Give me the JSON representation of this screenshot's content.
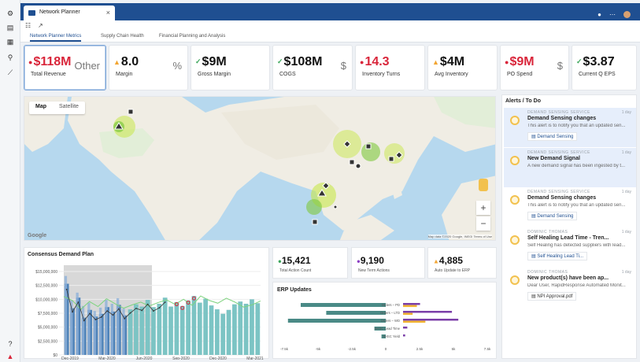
{
  "window": {
    "tab_title": "Network Planner"
  },
  "sidebar": {
    "icons": [
      "settings-icon",
      "document-icon",
      "calendar-icon",
      "pin-icon",
      "ruler-icon",
      "help-icon",
      "alert-icon"
    ]
  },
  "subtabs": [
    "Network Planner Metrics",
    "Supply Chain Health",
    "Financial Planning and Analysis"
  ],
  "kpis": [
    {
      "value": "$118M",
      "label": "Total Revenue",
      "trend": "down",
      "icon": "chart-icon",
      "icon_text": "Other"
    },
    {
      "value": "8.0",
      "label": "Margin",
      "trend": "up",
      "icon": "percent-icon",
      "icon_text": "%"
    },
    {
      "value": "$9M",
      "label": "Gross Margin",
      "trend": "check",
      "icon": "bar-chart-icon",
      "icon_text": ""
    },
    {
      "value": "$108M",
      "label": "COGS",
      "trend": "check",
      "icon": "coin-icon",
      "icon_text": "$"
    },
    {
      "value": "14.3",
      "label": "Inventory Turns",
      "trend": "down",
      "icon": "box-icon",
      "icon_text": ""
    },
    {
      "value": "$4M",
      "label": "Avg Inventory",
      "trend": "up",
      "icon": "boxes-icon",
      "icon_text": ""
    },
    {
      "value": "$9M",
      "label": "PO Spend",
      "trend": "down",
      "icon": "dollar-icon",
      "icon_text": "$"
    },
    {
      "value": "$3.87",
      "label": "Current Q EPS",
      "trend": "check",
      "icon": "calculator-icon",
      "icon_text": ""
    }
  ],
  "colors": {
    "down": "#d9253a",
    "up": "#f2a531",
    "check": "#3aa55a",
    "accent": "#1f4f91"
  },
  "map": {
    "mode_map": "Map",
    "mode_satellite": "Satellite",
    "zoom_in": "+",
    "zoom_out": "−",
    "attribution": "Map data ©2020 Google, INEGI   Terms of Use"
  },
  "alerts": {
    "title": "Alerts / To Do",
    "items": [
      {
        "source": "DEMAND SENSING SERVICE",
        "day": "1 day",
        "title": "Demand Sensing changes",
        "desc": "This alert is to notify you that an updated sen...",
        "link": "Demand Sensing",
        "highlight": true
      },
      {
        "source": "DEMAND SENSING SERVICE",
        "day": "1 day",
        "title": "New Demand Signal",
        "desc": "A new demand signal has been ingested by t...",
        "link": "",
        "highlight": true
      },
      {
        "source": "DEMAND SENSING SERVICE",
        "day": "1 day",
        "title": "Demand Sensing changes",
        "desc": "This alert is to notify you that an updated sen...",
        "link": "Demand Sensing",
        "highlight": false
      },
      {
        "source": "DOMINIC THOMAS",
        "day": "1 day",
        "title": "Self Healing Lead Time - Tren...",
        "desc": "Self Healing has detected suppliers with lead...",
        "link": "Self Healing Lead Ti...",
        "highlight": false
      },
      {
        "source": "DOMINIC THOMAS",
        "day": "1 day",
        "title": "New product(s) have been ap...",
        "desc": "Dear User, RapidResponse Automated Monit...",
        "link": "NPI Approval.pdf",
        "highlight": false
      }
    ]
  },
  "demand_plan": {
    "title": "Consensus Demand Plan"
  },
  "mini_kpis": [
    {
      "value": "15,421",
      "label": "Total Action Count",
      "color": "#3aa55a"
    },
    {
      "value": "9,190",
      "label": "New Term Actions",
      "color": "#8b3fc4"
    },
    {
      "value": "4,885",
      "label": "Auto Update to ERP",
      "color": "#f2a531"
    }
  ],
  "erp": {
    "title": "ERP Updates"
  },
  "chart_data": [
    {
      "type": "bar",
      "title": "Consensus Demand Plan",
      "x_ticks": [
        "Dec-2019",
        "Mar-2020",
        "Jun-2020",
        "Sep-2020",
        "Dec-2020",
        "Mar-2021"
      ],
      "y_ticks": [
        "$0",
        "$2,500,000",
        "$5,000,000",
        "$7,500,000",
        "$10,000,000",
        "$12,500,000",
        "$15,000,000"
      ],
      "ylim": [
        0,
        15000000
      ],
      "series": [
        {
          "values": [
            14200000,
            9800000,
            11200000,
            8800000,
            9400000,
            7900000,
            8500000,
            9900000,
            9200000,
            10200000,
            8300000,
            0,
            0,
            0,
            0,
            0,
            0,
            0,
            0,
            0,
            0,
            0,
            0,
            0,
            0,
            0,
            0,
            0,
            0,
            0,
            0,
            0,
            0,
            0,
            0,
            0,
            0,
            0,
            0,
            0,
            0,
            0,
            0,
            0,
            0,
            0,
            0,
            0
          ]
        },
        {
          "values": [
            12800000,
            8400000,
            10300000,
            6700000,
            8100000,
            6900000,
            7400000,
            8600000,
            7800000,
            9000000,
            7100000,
            8200000,
            9100000,
            8700000,
            9900000,
            8600000,
            9200000,
            10300000,
            8700000,
            9500000,
            8800000,
            9800000,
            10600000,
            9400000,
            10100000,
            8900000,
            8200000,
            7400000,
            8100000,
            9100000,
            9600000,
            9200000,
            10000000,
            9300000
          ]
        },
        {
          "values": [
            10500000,
            9800000,
            8200000,
            9600000,
            8700000,
            10100000,
            9200000,
            8400000,
            9000000,
            9500000,
            8800000,
            9400000,
            9900000,
            9100000,
            10000000,
            8900000,
            10600000,
            9800000,
            9300000,
            10200000,
            9500000,
            8600000,
            9000000,
            9700000
          ]
        }
      ],
      "grid": true
    },
    {
      "type": "bar",
      "title": "ERP Updates",
      "categories": [
        "Orders – PD",
        "Orders – LTD",
        "Orders – WD",
        "SHSC Lead Time",
        "SHSC Yield"
      ],
      "x_ticks": [
        "-7.5k",
        "-5k",
        "-2.5k",
        "0",
        "2.5k",
        "5k",
        "7.5k"
      ],
      "xlim": [
        -7500,
        7500
      ],
      "series": [
        {
          "values": [
            -6000,
            -4200,
            -6900,
            -800,
            -300
          ]
        },
        {
          "values": [
            1600,
            4600,
            5200,
            400,
            200
          ]
        },
        {
          "values": [
            1300,
            900,
            2100,
            0,
            0
          ]
        }
      ]
    }
  ]
}
